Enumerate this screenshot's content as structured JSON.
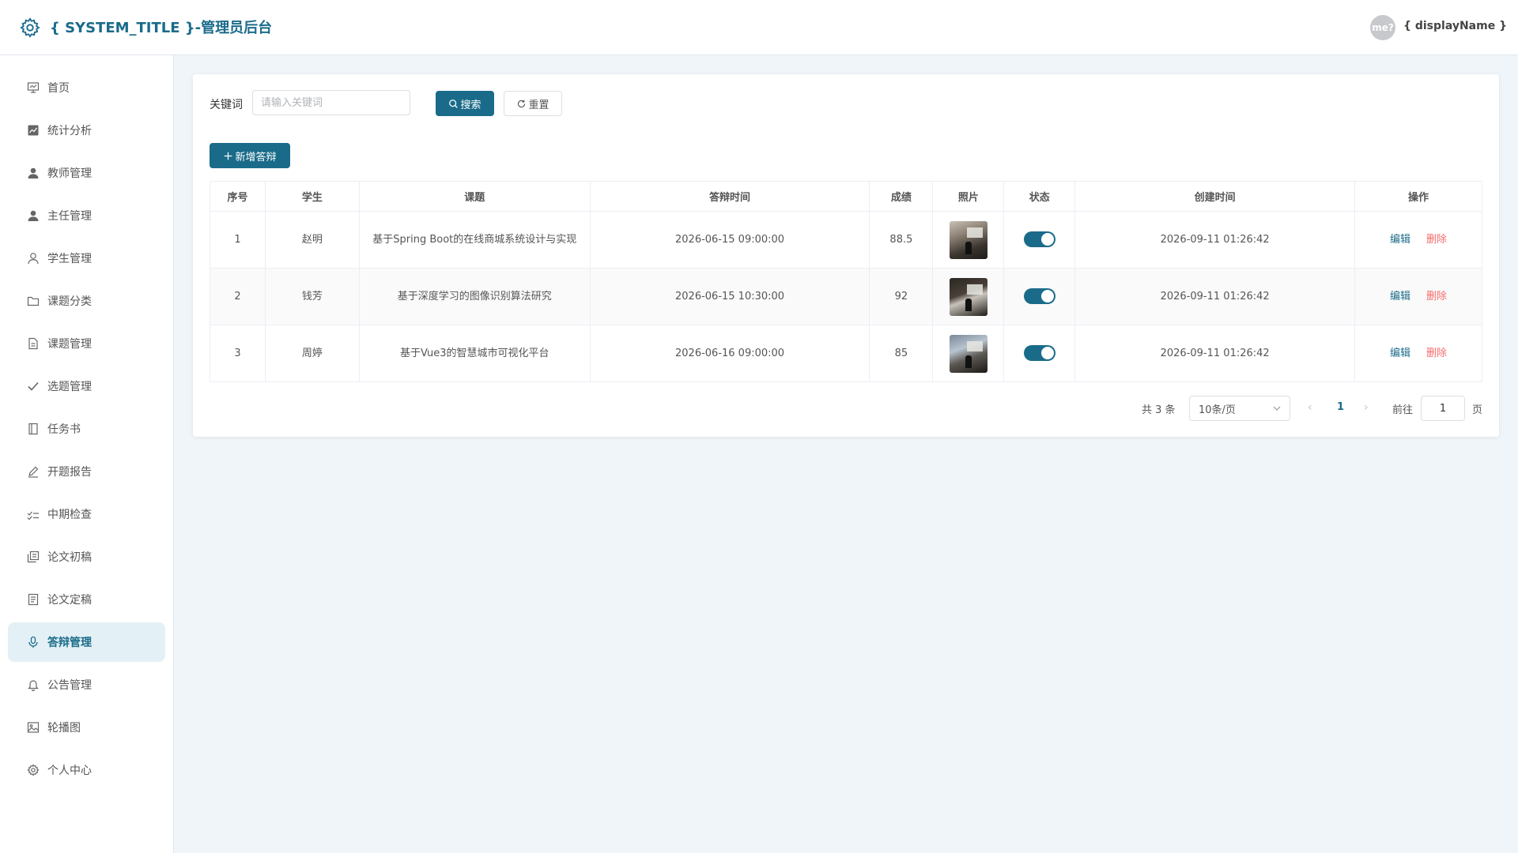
{
  "header": {
    "title": "{ SYSTEM_TITLE }-管理员后台",
    "avatar_text": "me?",
    "display_name": "{ displayName }"
  },
  "sidebar": {
    "items": [
      {
        "label": "首页",
        "icon": "chart-board-icon"
      },
      {
        "label": "统计分析",
        "icon": "line-chart-icon"
      },
      {
        "label": "教师管理",
        "icon": "user-filled-icon"
      },
      {
        "label": "主任管理",
        "icon": "user-filled-icon"
      },
      {
        "label": "学生管理",
        "icon": "user-outline-icon"
      },
      {
        "label": "课题分类",
        "icon": "folder-icon"
      },
      {
        "label": "课题管理",
        "icon": "document-icon"
      },
      {
        "label": "选题管理",
        "icon": "check-icon"
      },
      {
        "label": "任务书",
        "icon": "notebook-icon"
      },
      {
        "label": "开题报告",
        "icon": "edit-pen-icon"
      },
      {
        "label": "中期检查",
        "icon": "finished-icon"
      },
      {
        "label": "论文初稿",
        "icon": "copy-document-icon"
      },
      {
        "label": "论文定稿",
        "icon": "tickets-icon"
      },
      {
        "label": "答辩管理",
        "icon": "microphone-icon",
        "active": true
      },
      {
        "label": "公告管理",
        "icon": "bell-icon"
      },
      {
        "label": "轮播图",
        "icon": "picture-icon"
      },
      {
        "label": "个人中心",
        "icon": "setting-icon"
      }
    ]
  },
  "search": {
    "label": "关键词",
    "placeholder": "请输入关键词",
    "value": "",
    "search_button": "搜索",
    "reset_button": "重置"
  },
  "toolbar": {
    "add_button": "新增答辩"
  },
  "table": {
    "columns": [
      "序号",
      "学生",
      "课题",
      "答辩时间",
      "成绩",
      "照片",
      "状态",
      "创建时间",
      "操作"
    ],
    "rows": [
      {
        "index": "1",
        "student": "赵明",
        "topic": "基于Spring Boot的在线商城系统设计与实现",
        "defense_time": "2026-06-15 09:00:00",
        "score": "88.5",
        "status_on": true,
        "created": "2026-09-11 01:26:42",
        "edit": "编辑",
        "delete": "删除"
      },
      {
        "index": "2",
        "student": "钱芳",
        "topic": "基于深度学习的图像识别算法研究",
        "defense_time": "2026-06-15 10:30:00",
        "score": "92",
        "status_on": true,
        "created": "2026-09-11 01:26:42",
        "edit": "编辑",
        "delete": "删除"
      },
      {
        "index": "3",
        "student": "周婷",
        "topic": "基于Vue3的智慧城市可视化平台",
        "defense_time": "2026-06-16 09:00:00",
        "score": "85",
        "status_on": true,
        "created": "2026-09-11 01:26:42",
        "edit": "编辑",
        "delete": "删除"
      }
    ]
  },
  "pagination": {
    "total_text": "共 3 条",
    "page_size": "10条/页",
    "current_page": "1",
    "goto_label": "前往",
    "goto_value": "1",
    "page_suffix": "页"
  },
  "colors": {
    "primary": "#1a6b8a",
    "danger": "#f56c6c",
    "background": "#f0f5f9",
    "active_menu_bg": "#e3f0f5"
  }
}
